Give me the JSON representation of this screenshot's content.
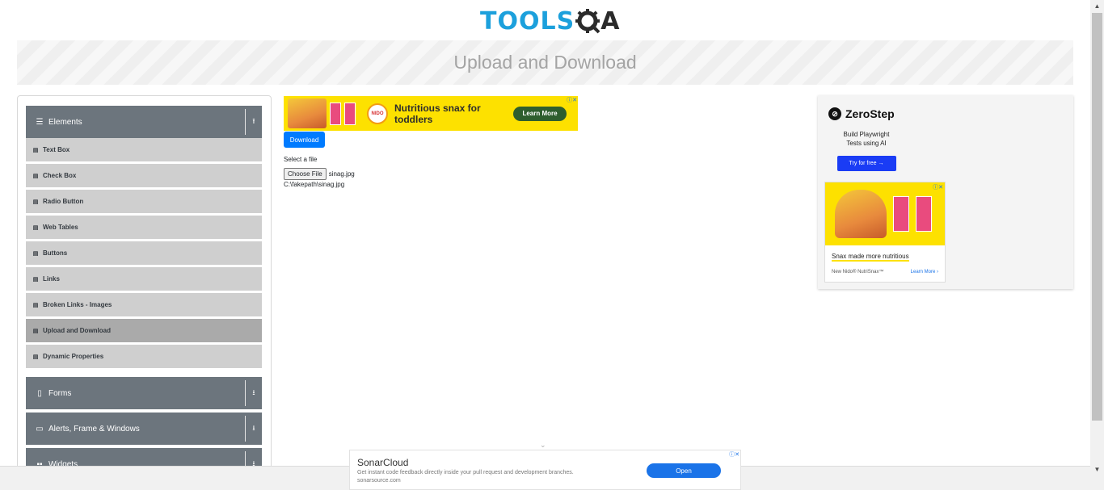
{
  "header": {
    "logo_text_main": "TOOLS",
    "logo_text_end": "A",
    "page_title": "Upload and Download"
  },
  "sidebar": {
    "groups": [
      {
        "label": "Elements",
        "icon": "menu-icon",
        "toggle_icon": "upload-arrow-icon",
        "expanded": true
      },
      {
        "label": "Forms",
        "icon": "form-icon",
        "toggle_icon": "download-arrow-icon",
        "expanded": false
      },
      {
        "label": "Alerts, Frame & Windows",
        "icon": "window-icon",
        "toggle_icon": "download-arrow-icon",
        "expanded": false
      },
      {
        "label": "Widgets",
        "icon": "widgets-icon",
        "toggle_icon": "download-arrow-icon",
        "expanded": false
      }
    ],
    "items": [
      {
        "label": "Text Box"
      },
      {
        "label": "Check Box"
      },
      {
        "label": "Radio Button"
      },
      {
        "label": "Web Tables"
      },
      {
        "label": "Buttons"
      },
      {
        "label": "Links"
      },
      {
        "label": "Broken Links - Images"
      },
      {
        "label": "Upload and Download",
        "active": true
      },
      {
        "label": "Dynamic Properties"
      }
    ]
  },
  "main": {
    "top_ad": {
      "text": "Nutritious snax for toddlers",
      "button": "Learn More"
    },
    "download_label": "Download",
    "select_label": "Select a file",
    "choose_button": "Choose File",
    "file_name": "sinag.jpg",
    "uploaded_path": "C:\\fakepath\\sinag.jpg"
  },
  "right_ad": {
    "brand": "ZeroStep",
    "tagline_1": "Build Playwright",
    "tagline_2": "Tests using AI",
    "cta": "Try for free →",
    "nido_headline": "Snax made more nutritious",
    "nido_sub": "New Nido® NutriSnax™",
    "nido_learn": "Learn More ›"
  },
  "bottom_ad": {
    "name": "SonarCloud",
    "description": "Get instant code feedback directly inside your pull request and development branches.",
    "url": "sonarsource.com",
    "open_label": "Open"
  },
  "colors": {
    "primary": "#007bff",
    "sidebar_group": "#6c757d",
    "sidebar_item": "#cfcfcf",
    "sidebar_item_active": "#aaaaaa",
    "logo_blue": "#1ca0dc"
  }
}
